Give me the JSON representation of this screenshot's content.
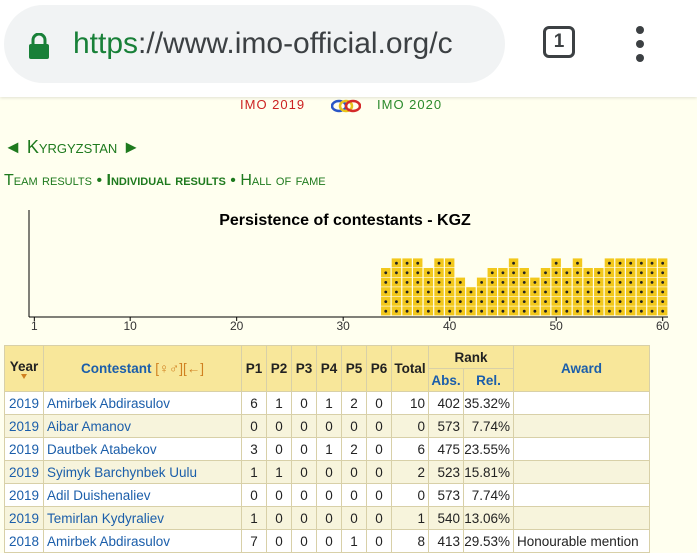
{
  "browser": {
    "url_scheme": "https",
    "url_rest": "://www.imo-official.org/c",
    "tab_count": "1",
    "icons": [
      "lock-icon",
      "tab-switcher-icon",
      "overflow-menu-icon"
    ]
  },
  "imo_nav": {
    "prev": "IMO 2019",
    "next": "IMO 2020"
  },
  "page": {
    "country": "◄ Kyrgyzstan ►",
    "tabs": {
      "team": "Team results",
      "sep1": "•",
      "individual": "Individual results",
      "sep2": "•",
      "hall": "Hall of fame"
    }
  },
  "chart_data": {
    "type": "heatmap",
    "title": "Persistence of contestants - KGZ",
    "x_ticks": [
      1,
      10,
      20,
      30,
      40,
      50,
      60
    ],
    "xlim": [
      1,
      60
    ],
    "active_x_range": [
      34,
      60
    ],
    "column_heights": [
      0,
      0,
      0,
      0,
      0,
      0,
      0,
      0,
      0,
      0,
      0,
      0,
      0,
      0,
      0,
      0,
      0,
      0,
      0,
      0,
      0,
      0,
      0,
      0,
      0,
      0,
      0,
      0,
      0,
      0,
      0,
      0,
      0,
      5,
      6,
      6,
      6,
      5,
      6,
      6,
      4,
      3,
      4,
      5,
      5,
      6,
      5,
      4,
      5,
      6,
      5,
      6,
      5,
      5,
      6,
      6,
      6,
      6,
      6,
      6
    ],
    "cell_color": "#f2c81c",
    "dot_color": "#222222"
  },
  "table": {
    "headers": {
      "year": "Year",
      "contestant": "Contestant",
      "sort_links": "[♀♂][←]",
      "problems": [
        "P1",
        "P2",
        "P3",
        "P4",
        "P5",
        "P6"
      ],
      "total": "Total",
      "rank": "Rank",
      "abs": "Abs.",
      "rel": "Rel.",
      "award": "Award"
    },
    "rows": [
      {
        "year": "2019",
        "name": "Amirbek Abdirasulov",
        "p": [
          "6",
          "1",
          "0",
          "1",
          "2",
          "0"
        ],
        "total": "10",
        "abs": "402",
        "rel": "35.32%",
        "award": ""
      },
      {
        "year": "2019",
        "name": "Aibar Amanov",
        "p": [
          "0",
          "0",
          "0",
          "0",
          "0",
          "0"
        ],
        "total": "0",
        "abs": "573",
        "rel": "7.74%",
        "award": ""
      },
      {
        "year": "2019",
        "name": "Dautbek Atabekov",
        "p": [
          "3",
          "0",
          "0",
          "1",
          "2",
          "0"
        ],
        "total": "6",
        "abs": "475",
        "rel": "23.55%",
        "award": ""
      },
      {
        "year": "2019",
        "name": "Syimyk Barchynbek Uulu",
        "p": [
          "1",
          "1",
          "0",
          "0",
          "0",
          "0"
        ],
        "total": "2",
        "abs": "523",
        "rel": "15.81%",
        "award": ""
      },
      {
        "year": "2019",
        "name": "Adil Duishenaliev",
        "p": [
          "0",
          "0",
          "0",
          "0",
          "0",
          "0"
        ],
        "total": "0",
        "abs": "573",
        "rel": "7.74%",
        "award": ""
      },
      {
        "year": "2019",
        "name": "Temirlan Kydyraliev",
        "p": [
          "1",
          "0",
          "0",
          "0",
          "0",
          "0"
        ],
        "total": "1",
        "abs": "540",
        "rel": "13.06%",
        "award": ""
      },
      {
        "year": "2018",
        "name": "Amirbek Abdirasulov",
        "p": [
          "7",
          "0",
          "0",
          "0",
          "1",
          "0"
        ],
        "total": "8",
        "abs": "413",
        "rel": "29.53%",
        "award": "Honourable mention"
      }
    ]
  }
}
